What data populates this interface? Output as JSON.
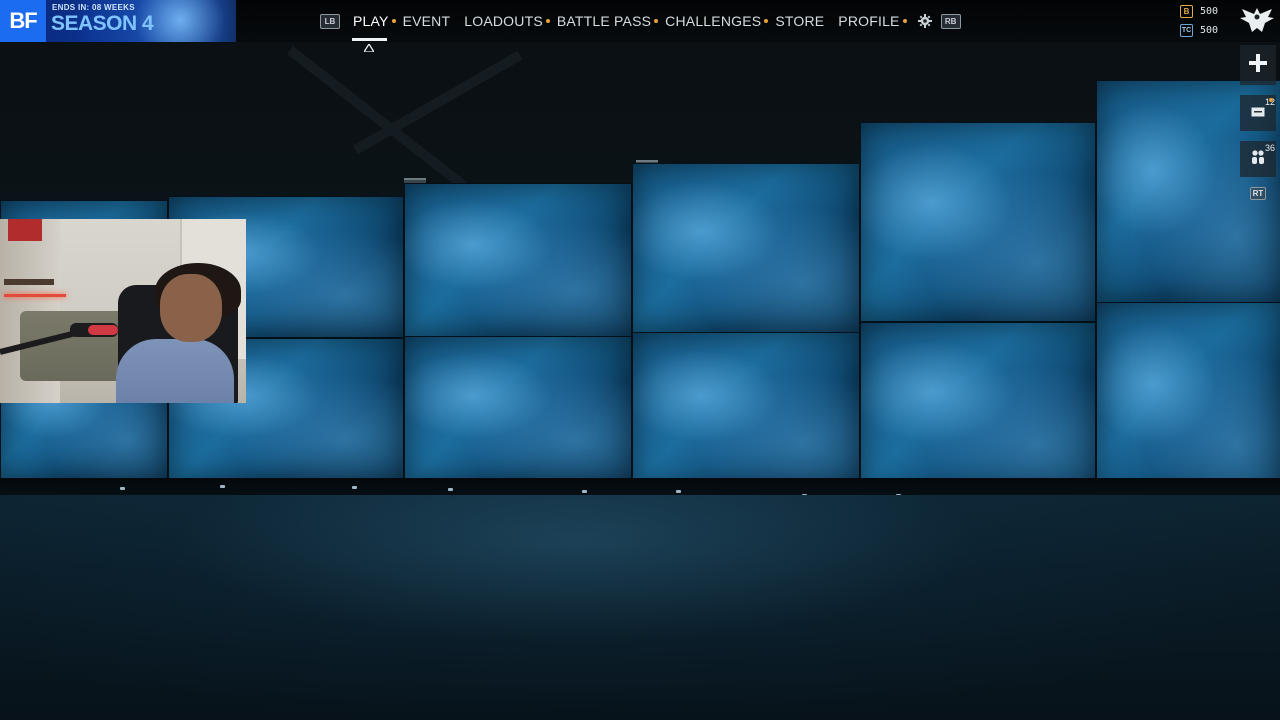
{
  "brand": {
    "logo": "BF",
    "season_ends": "ENDS IN: 08 WEEKS",
    "season_title": "SEASON 4"
  },
  "nav": {
    "left_bumper": "LB",
    "right_bumper": "RB",
    "items": [
      {
        "label": "PLAY",
        "active": true,
        "dot": true
      },
      {
        "label": "EVENT",
        "active": false,
        "dot": false
      },
      {
        "label": "LOADOUTS",
        "active": false,
        "dot": true
      },
      {
        "label": "BATTLE PASS",
        "active": false,
        "dot": true
      },
      {
        "label": "CHALLENGES",
        "active": false,
        "dot": true
      },
      {
        "label": "STORE",
        "active": false,
        "dot": false
      },
      {
        "label": "PROFILE",
        "active": false,
        "dot": true
      }
    ],
    "settings_icon": "gear-icon",
    "indicator_icon": "caret-up-icon"
  },
  "currency": {
    "bf_coins": {
      "icon_letter": "B",
      "value": "500"
    },
    "tc": {
      "icon_letter": "TC",
      "value": "500"
    }
  },
  "rank_icon": "eagle-rank-icon",
  "rail": {
    "add_icon": "plus-icon",
    "messages": {
      "icon": "mail-icon",
      "count": "12"
    },
    "friends": {
      "icon": "friends-icon",
      "count": "36"
    },
    "trigger": "RT"
  },
  "colors": {
    "accent_orange": "#e8a23a",
    "brand_blue": "#1b6cf0",
    "screen_cyan": "#1a6d9c"
  }
}
